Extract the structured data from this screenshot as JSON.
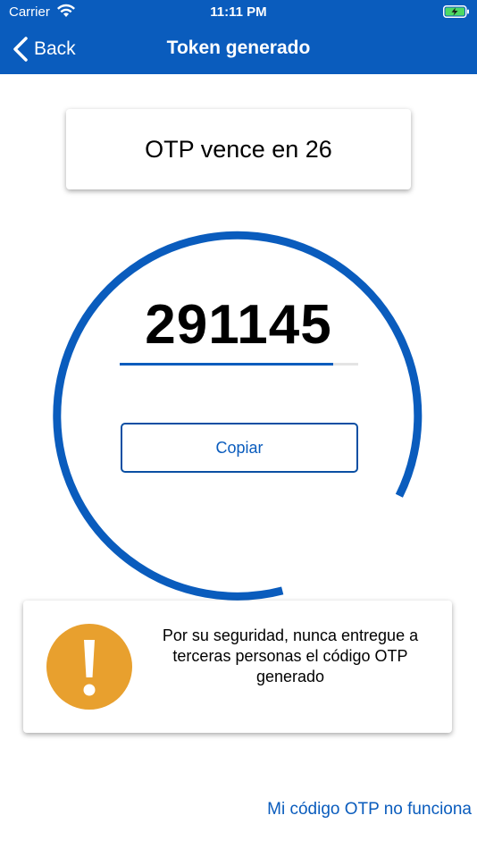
{
  "status_bar": {
    "carrier": "Carrier",
    "time": "11:11 PM",
    "wifi_icon": "wifi-icon",
    "battery_icon": "battery-charging-icon"
  },
  "nav": {
    "back_label": "Back",
    "back_icon": "chevron-left-icon",
    "title": "Token generado"
  },
  "otp": {
    "expiry_text": "OTP vence en 26",
    "token": "291145",
    "progress_fraction": 0.897,
    "copy_label": "Copiar"
  },
  "warning": {
    "icon": "exclamation-icon",
    "message": "Por su seguridad, nunca entregue a terceras personas el código OTP generado"
  },
  "footer": {
    "help_link": "Mi código OTP no funciona"
  },
  "colors": {
    "primary": "#0a5cbd",
    "warning": "#e8a02e",
    "header_text": "#ffffff"
  }
}
